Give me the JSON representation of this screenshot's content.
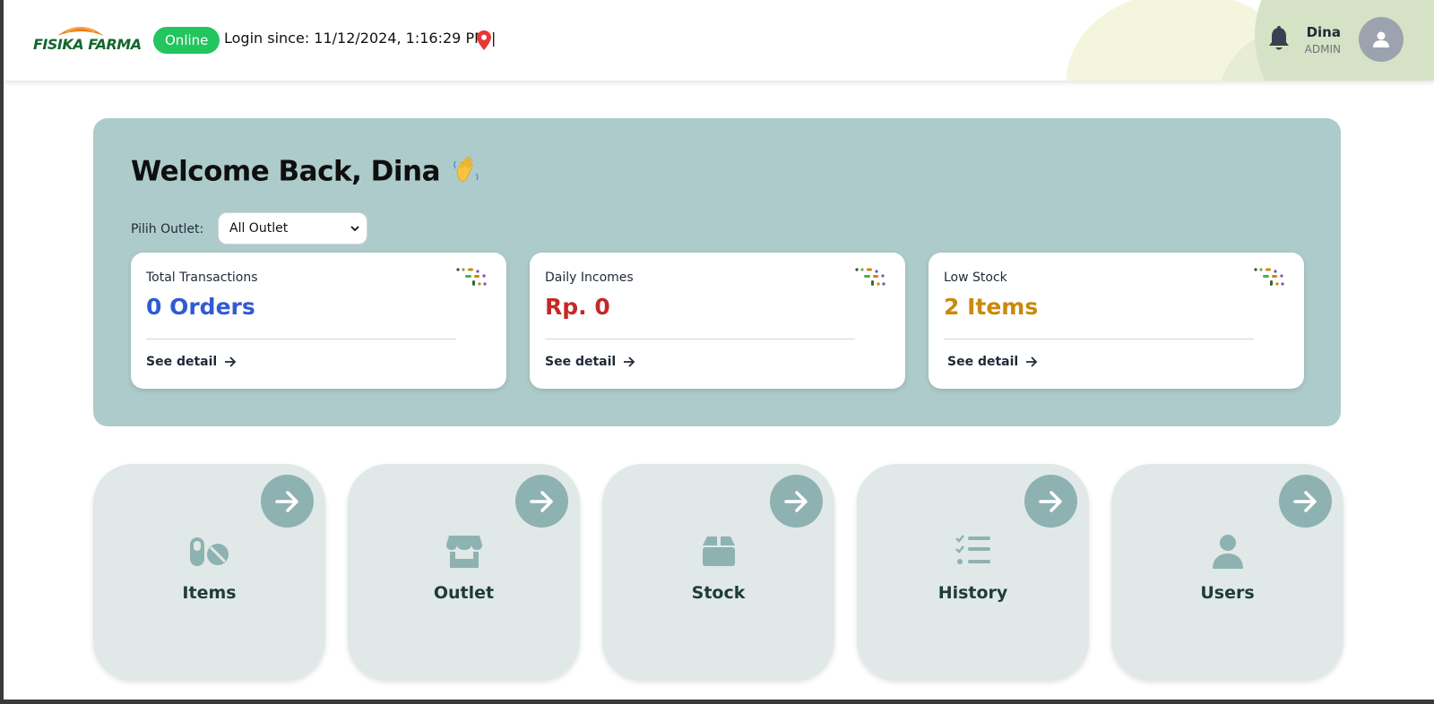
{
  "header": {
    "brand": "FISIKA FARMA",
    "status": "Online",
    "login_text": "Login since: 11/12/2024, 1:16:29 PM  |",
    "user_name": "Dina",
    "user_role": "ADMIN",
    "icons": [
      "location-pin-icon",
      "bell-icon",
      "user-icon"
    ]
  },
  "hero": {
    "welcome": "Welcome Back, Dina",
    "outlet_label": "Pilih Outlet:",
    "outlet_selected": "All Outlet",
    "cards": [
      {
        "title": "Total Transactions",
        "value": "0 Orders",
        "link": "See detail",
        "color": "#2f5bd3"
      },
      {
        "title": "Daily Incomes",
        "value": "Rp. 0",
        "link": "See detail",
        "color": "#c62828"
      },
      {
        "title": "Low Stock",
        "value": "2 Items",
        "link": "See detail",
        "color": "#c98a0b"
      }
    ]
  },
  "tiles": [
    {
      "label": "Items",
      "icon": "pills-icon"
    },
    {
      "label": "Outlet",
      "icon": "store-icon"
    },
    {
      "label": "Stock",
      "icon": "box-icon"
    },
    {
      "label": "History",
      "icon": "checklist-icon"
    },
    {
      "label": "Users",
      "icon": "user-icon"
    }
  ],
  "colors": {
    "hero_bg": "#adcbca",
    "tile_bg": "#e0e9e8",
    "tile_accent": "#8eb2b1",
    "status_green": "#22c55e"
  }
}
